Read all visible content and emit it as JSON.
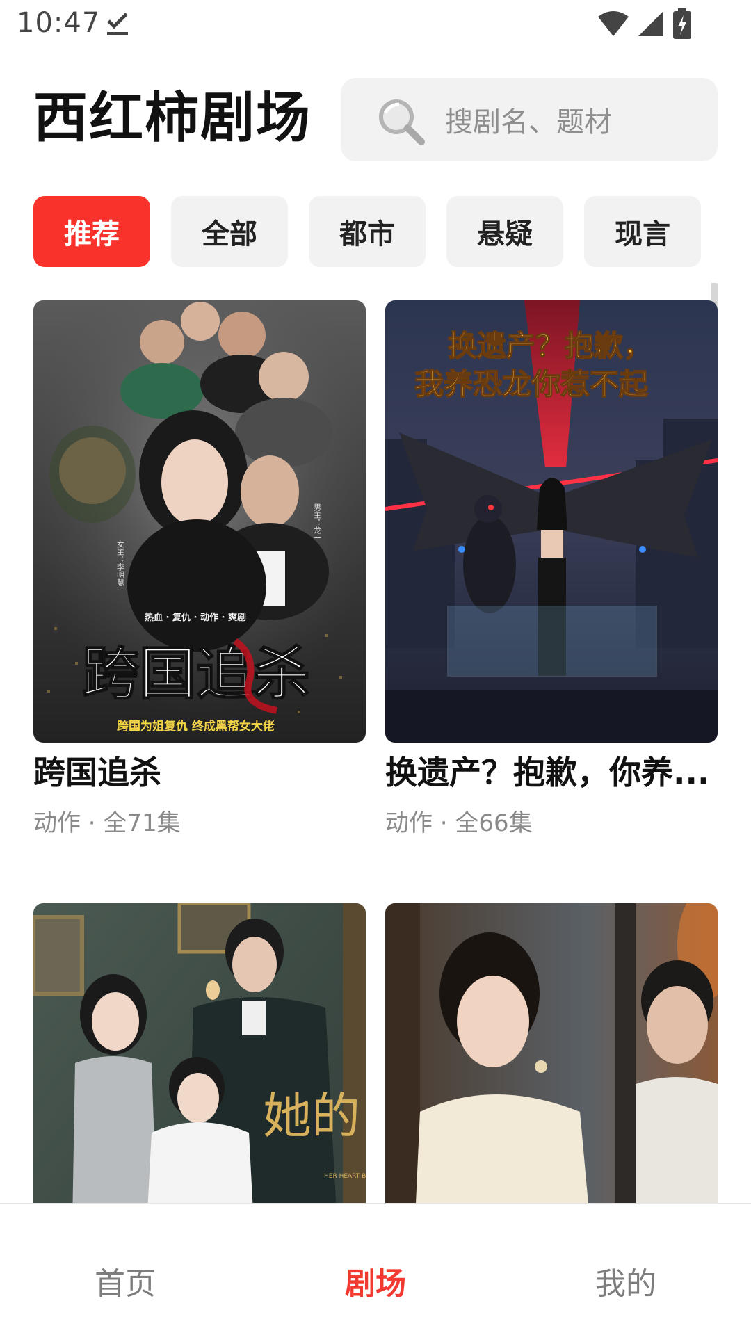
{
  "status_bar": {
    "time": "10:47"
  },
  "header": {
    "title": "西红柿剧场"
  },
  "search": {
    "placeholder": "搜剧名、题材"
  },
  "tabs": [
    {
      "label": "推荐",
      "active": true
    },
    {
      "label": "全部",
      "active": false
    },
    {
      "label": "都市",
      "active": false
    },
    {
      "label": "悬疑",
      "active": false
    },
    {
      "label": "现言",
      "active": false
    }
  ],
  "cards": [
    {
      "title": "跨国追杀",
      "meta": "动作 · 全71集",
      "poster": {
        "title_text": "跨国追杀",
        "tags": "热血 · 复仇 · 动作 · 爽剧",
        "tagline": "跨国为姐复仇  终成黑帮女大佬",
        "left_credit": "女主：李明慧",
        "right_credit": "男主：龙一"
      }
    },
    {
      "title": "换遗产？抱歉，你养...",
      "meta": "动作 · 全66集",
      "poster": {
        "line1": "换遗产？抱歉，",
        "line2": "我养恐龙你惹不起"
      }
    },
    {
      "title": "",
      "meta": "",
      "poster": {
        "title_text": "她的",
        "subtitle": "HER HEART BIRD"
      }
    },
    {
      "title": "",
      "meta": "",
      "poster": {}
    }
  ],
  "bottom_nav": [
    {
      "label": "首页",
      "active": false
    },
    {
      "label": "剧场",
      "active": true
    },
    {
      "label": "我的",
      "active": false
    }
  ],
  "colors": {
    "accent": "#f9322c",
    "tab_bg": "#f2f2f2",
    "muted_text": "#8a8a8a"
  }
}
